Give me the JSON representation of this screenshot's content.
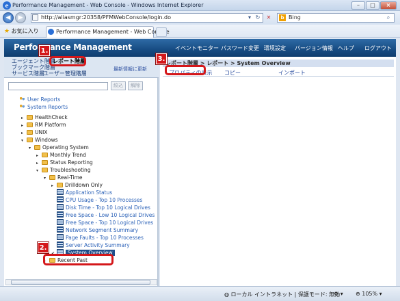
{
  "window": {
    "title": "Performance Management - Web Console - Windows Internet Explorer",
    "url": "http://aliasmgr:20358/PFMWebConsole/login.do",
    "search_placeholder": "Bing",
    "favorites_label": "お気に入り",
    "tab_label": "Performance Management - Web Console"
  },
  "app": {
    "title": "Performance Management",
    "nav": [
      "イベントモニター",
      "パスワード変更",
      "環境設定",
      "バージョン情報",
      "ヘルプ",
      "ログアウト"
    ]
  },
  "left_tabs": {
    "agent_tier": "エージェント階層",
    "report_tier": "レポート階層",
    "bookmark_tier": "ブックマーク階層",
    "service_tier": "サービス階層",
    "user_mgmt_tier": "ユーザー管理階層",
    "reload": "最新情報に更新",
    "narrow_button": "絞込",
    "clear_button": "解除"
  },
  "tree": [
    {
      "label": "User Reports",
      "icon": "people-icon",
      "indent": 0,
      "expander": "",
      "kind": "root"
    },
    {
      "label": "System Reports",
      "icon": "people-icon",
      "indent": 0,
      "expander": "",
      "kind": "root"
    },
    {
      "label": "HealthCheck",
      "icon": "folder-icon",
      "indent": 1,
      "expander": "▸",
      "kind": "folder"
    },
    {
      "label": "RM Platform",
      "icon": "folder-icon",
      "indent": 1,
      "expander": "▸",
      "kind": "folder"
    },
    {
      "label": "UNIX",
      "icon": "folder-icon",
      "indent": 1,
      "expander": "▸",
      "kind": "folder"
    },
    {
      "label": "Windows",
      "icon": "folder-icon",
      "indent": 1,
      "expander": "▾",
      "kind": "folder"
    },
    {
      "label": "Operating System",
      "icon": "folder-icon",
      "indent": 2,
      "expander": "▾",
      "kind": "folder"
    },
    {
      "label": "Monthly Trend",
      "icon": "folder-icon",
      "indent": 3,
      "expander": "▸",
      "kind": "folder"
    },
    {
      "label": "Status Reporting",
      "icon": "folder-icon",
      "indent": 3,
      "expander": "▸",
      "kind": "folder"
    },
    {
      "label": "Troubleshooting",
      "icon": "folder-icon",
      "indent": 3,
      "expander": "▾",
      "kind": "folder"
    },
    {
      "label": "Real-Time",
      "icon": "folder-icon",
      "indent": 4,
      "expander": "▾",
      "kind": "folder"
    },
    {
      "label": "Drilldown Only",
      "icon": "folder-icon",
      "indent": 5,
      "expander": "▸",
      "kind": "folder"
    },
    {
      "label": "Application Status",
      "icon": "report-icon",
      "indent": 5,
      "expander": "",
      "kind": "report"
    },
    {
      "label": "CPU Usage - Top 10 Processes",
      "icon": "report-icon",
      "indent": 5,
      "expander": "",
      "kind": "report"
    },
    {
      "label": "Disk Time - Top 10 Logical Drives",
      "icon": "report-icon",
      "indent": 5,
      "expander": "",
      "kind": "report"
    },
    {
      "label": "Free Space - Low 10 Logical Drives",
      "icon": "report-icon",
      "indent": 5,
      "expander": "",
      "kind": "report"
    },
    {
      "label": "Free Space - Top 10 Logical Drives",
      "icon": "report-icon",
      "indent": 5,
      "expander": "",
      "kind": "report"
    },
    {
      "label": "Network Segment Summary",
      "icon": "report-icon",
      "indent": 5,
      "expander": "",
      "kind": "report"
    },
    {
      "label": "Page Faults - Top 10 Processes",
      "icon": "report-icon",
      "indent": 5,
      "expander": "",
      "kind": "report"
    },
    {
      "label": "Server Activity Summary",
      "icon": "report-icon",
      "indent": 5,
      "expander": "",
      "kind": "report"
    },
    {
      "label": "System Overview",
      "icon": "report-icon",
      "indent": 5,
      "expander": "✔",
      "kind": "selected"
    },
    {
      "label": "Recent Past",
      "icon": "folder-icon",
      "indent": 4,
      "expander": "▸",
      "kind": "folder"
    }
  ],
  "right": {
    "breadcrumb": "レポート階層 > レポート > System Overview",
    "menu": [
      "プロパティの表示",
      "コピー",
      "インポート"
    ]
  },
  "status": {
    "zone": "ローカル イントラネット | 保護モード: 無効",
    "zoom": "105%"
  },
  "callouts": [
    "1.",
    "2.",
    "3."
  ]
}
